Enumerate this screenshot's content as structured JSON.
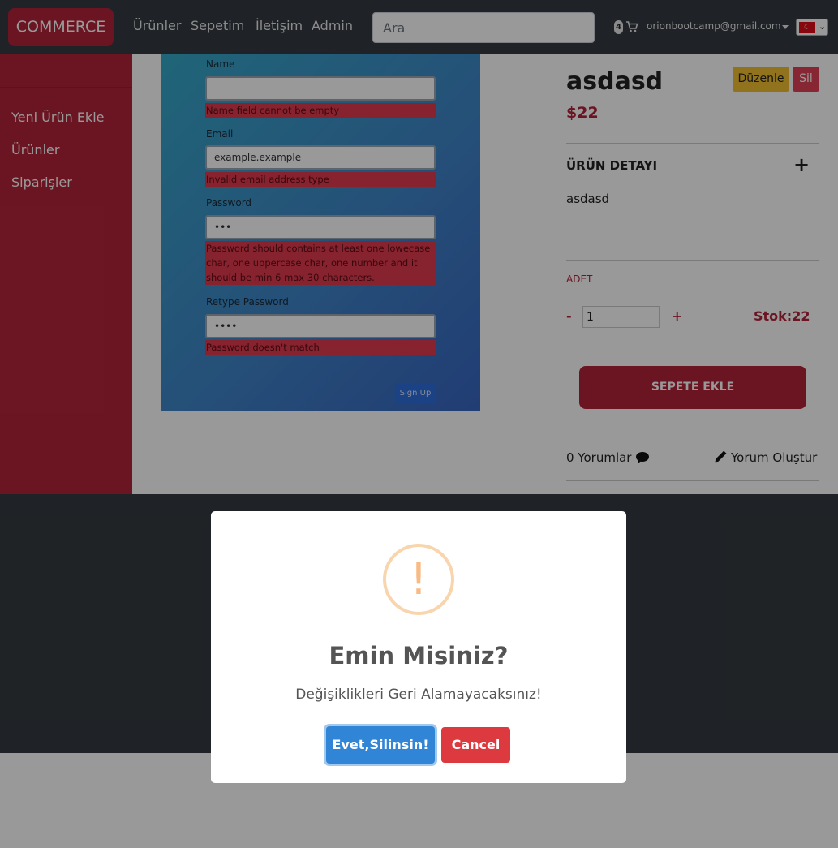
{
  "navbar": {
    "brand": "COMMERCE",
    "links": [
      "Ürünler",
      "Sepetim",
      "İletişim",
      "Admin"
    ],
    "search_placeholder": "Ara",
    "cart_count": "4",
    "user_email": "orionbootcamp@gmail.com",
    "language_flag": "tr-flag"
  },
  "sidebar": {
    "items": [
      "Yeni Ürün Ekle",
      "Ürünler",
      "Siparişler"
    ]
  },
  "product_image": {
    "fields": [
      {
        "label": "Name",
        "value": "",
        "error": "Name field cannot be empty"
      },
      {
        "label": "Email",
        "value": "example.example",
        "error": "Invalid email address type"
      },
      {
        "label": "Password",
        "value": "•••",
        "error": "Password should contains at least one lowecase char, one uppercase char, one number and it should be min 6 max 30 characters."
      },
      {
        "label": "Retype Password",
        "value": "••••",
        "error": "Password doesn't match"
      }
    ],
    "signup_label": "Sign Up"
  },
  "product": {
    "title": "asdasd",
    "price": "$22",
    "edit_label": "Düzenle",
    "delete_label": "Sil",
    "detail_heading": "ÜRÜN DETAYI",
    "detail_text": "asdasd",
    "quantity_label": "ADET",
    "quantity_value": "1",
    "minus_label": "-",
    "plus_label": "+",
    "stock": "Stok:22",
    "add_to_cart": "SEPETE EKLE",
    "comments": "0 Yorumlar",
    "write_comment": "Yorum Oluştur"
  },
  "modal": {
    "icon": "!",
    "title": "Emin Misiniz?",
    "text": "Değişiklikleri Geri Alamayacaksınız!",
    "confirm": "Evet,Silinsin!",
    "cancel": "Cancel"
  },
  "colors": {
    "brand_red": "#b4243a",
    "navbar_dark": "#343a40",
    "confirm_blue": "#3085d6",
    "cancel_red": "#dd3a3f",
    "warning_orange": "#f8bb86",
    "edit_yellow": "#f0c030"
  }
}
